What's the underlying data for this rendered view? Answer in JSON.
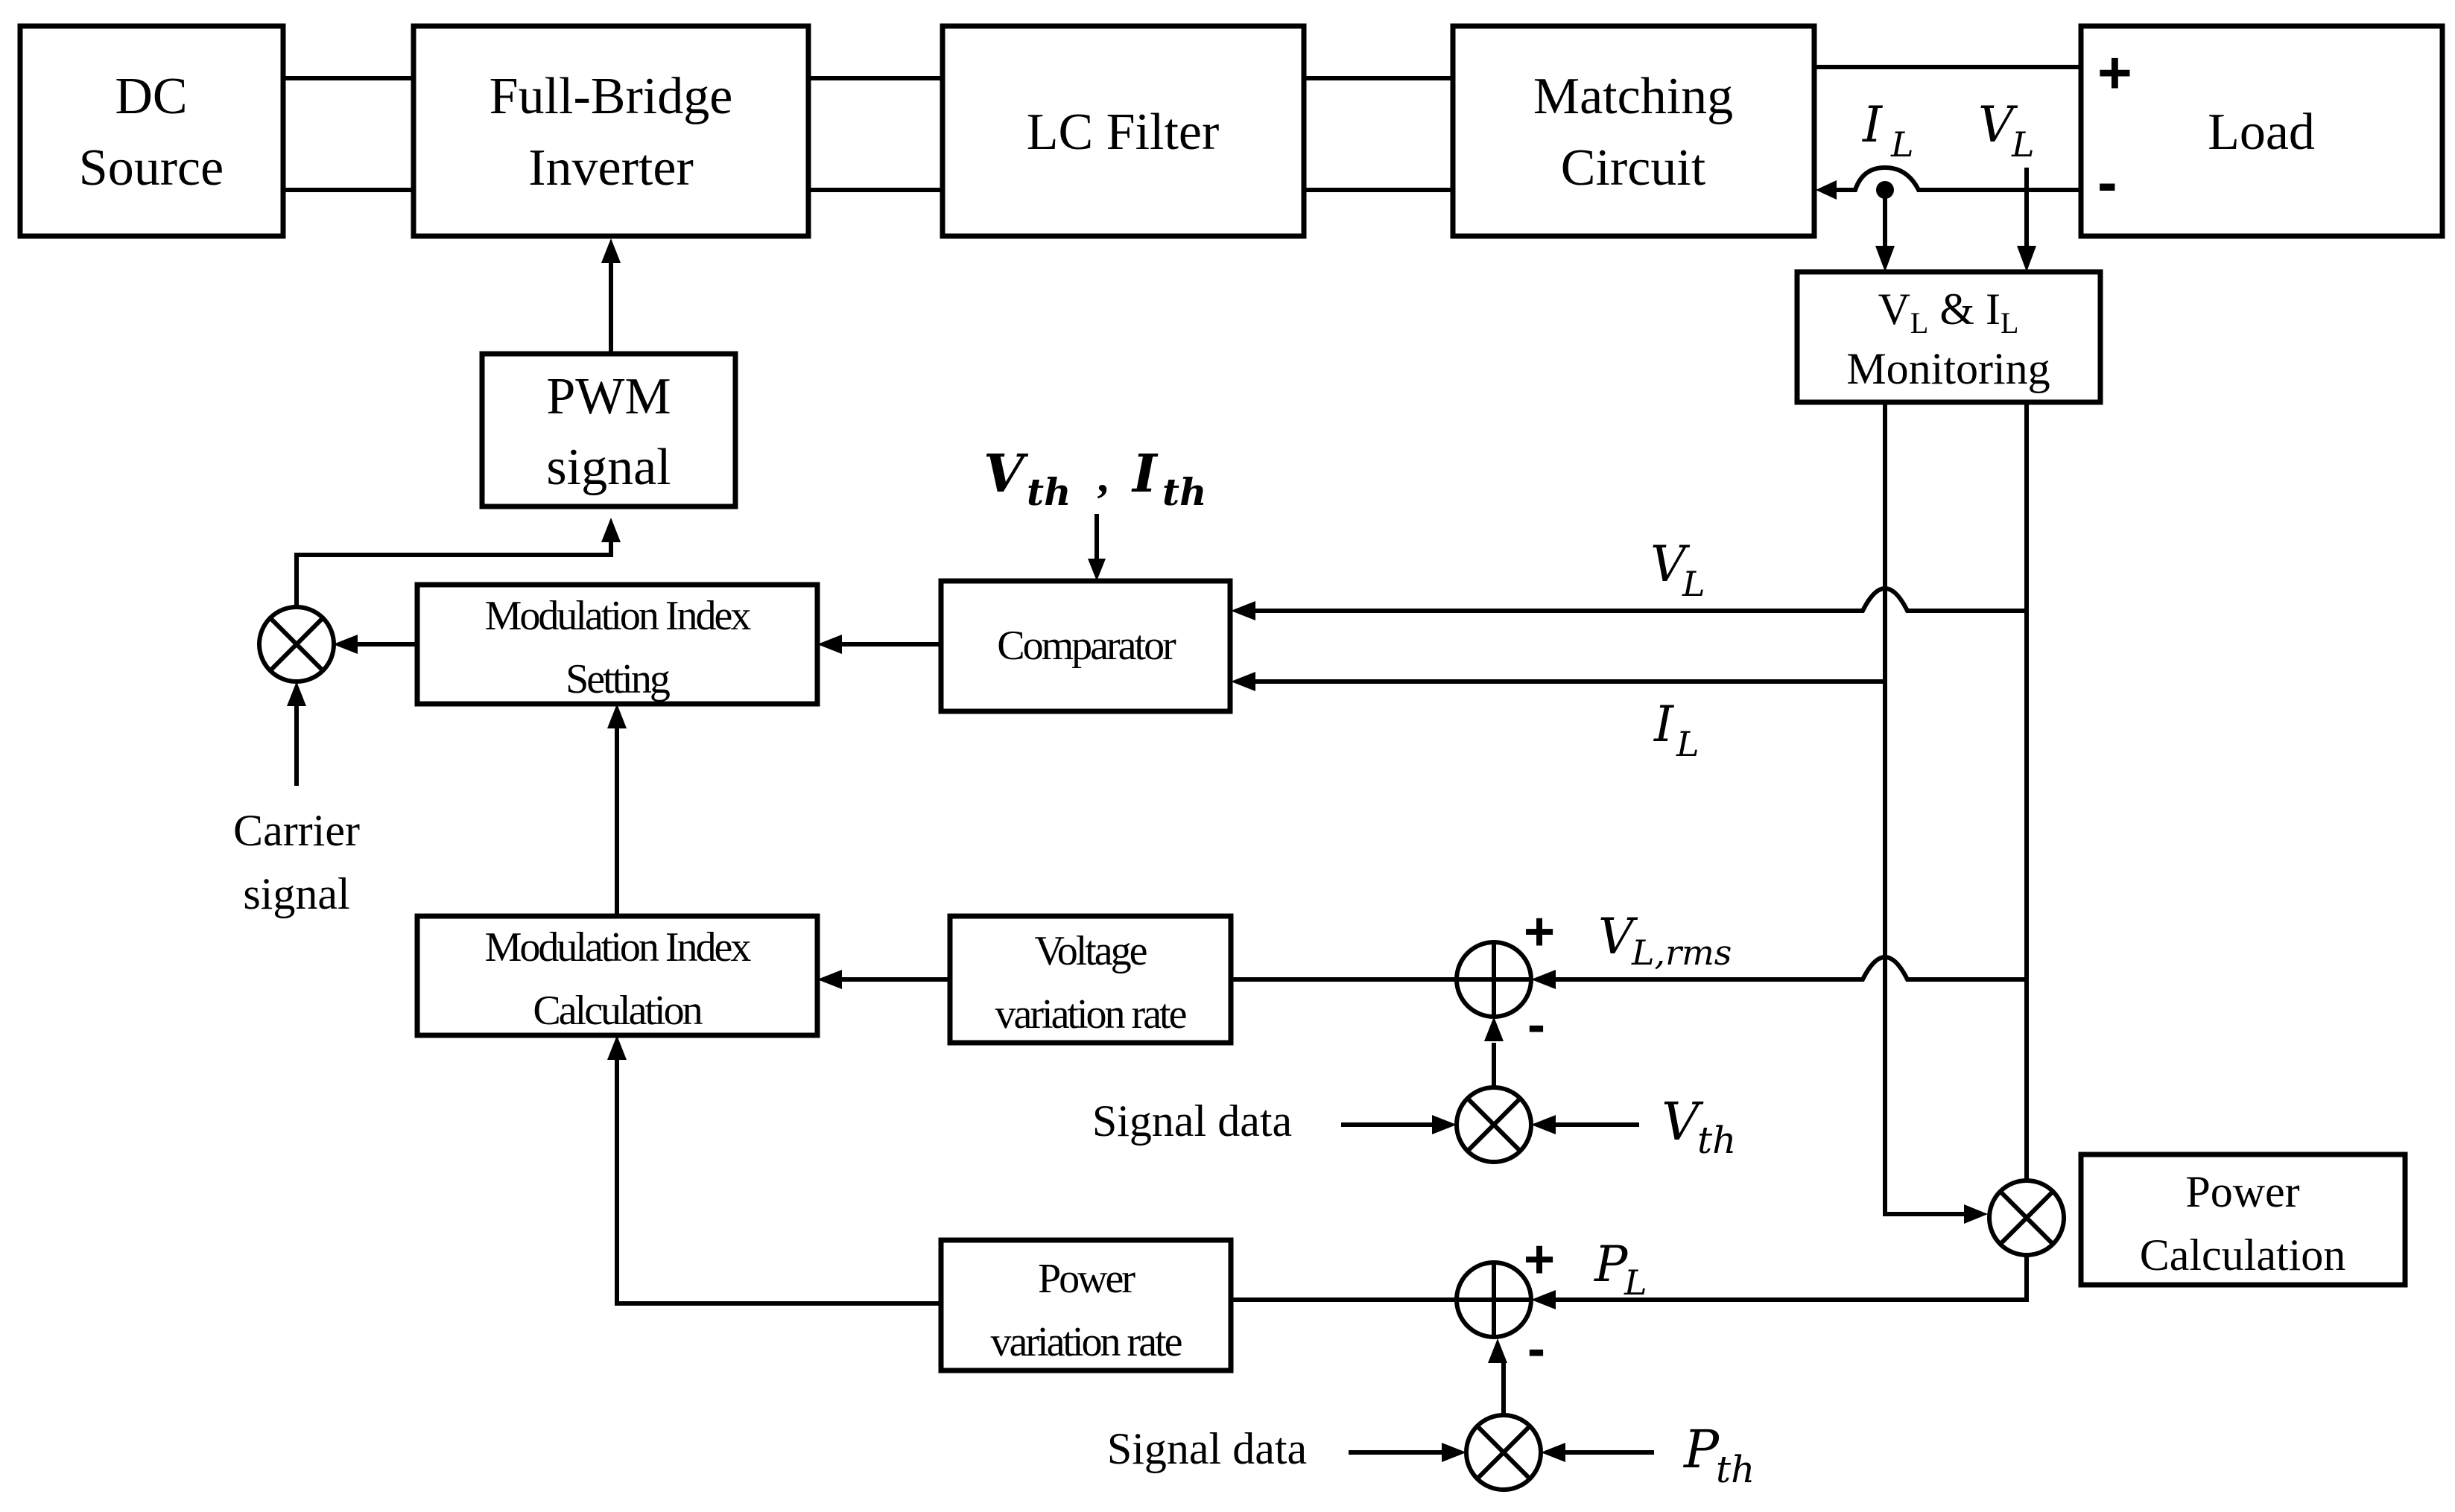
{
  "blocks": {
    "dc_source": [
      "DC",
      "Source"
    ],
    "inverter": [
      "Full-Bridge",
      "Inverter"
    ],
    "lc_filter": [
      "LC Filter"
    ],
    "matching": [
      "Matching",
      "Circuit"
    ],
    "load": [
      "Load"
    ],
    "monitoring": [
      "V",
      "L",
      " & I",
      "L",
      "Monitoring"
    ],
    "pwm": [
      "PWM",
      "signal"
    ],
    "mod_setting": [
      "Modulation Index",
      "Setting"
    ],
    "comparator": [
      "Comparator"
    ],
    "mod_calc": [
      "Modulation Index",
      "Calculation"
    ],
    "voltage_rate": [
      "Voltage",
      "variation rate"
    ],
    "power_rate": [
      "Power",
      "variation rate"
    ],
    "power_calc": [
      "Power",
      "Calculation"
    ]
  },
  "labels": {
    "load_plus": "+",
    "load_minus": "-",
    "il_top": {
      "main": "I",
      "sub": "L"
    },
    "vl_top": {
      "main": "V",
      "sub": "L"
    },
    "vth_ith": {
      "v": "V",
      "vsub": "th",
      "sep": " , ",
      "i": "I",
      "isub": "th"
    },
    "vl_line": {
      "main": "V",
      "sub": "L"
    },
    "il_line": {
      "main": "I",
      "sub": "L"
    },
    "carrier": [
      "Carrier",
      "signal"
    ],
    "vlrms": {
      "main": "V",
      "sub": "L,rms"
    },
    "pl": {
      "main": "P",
      "sub": "L"
    },
    "vth": {
      "main": "V",
      "sub": "th"
    },
    "pth": {
      "main": "P",
      "sub": "th"
    },
    "signal_data_1": "Signal data",
    "signal_data_2": "Signal data",
    "plus_1": "+",
    "minus_1": "-",
    "plus_2": "+",
    "minus_2": "-"
  }
}
